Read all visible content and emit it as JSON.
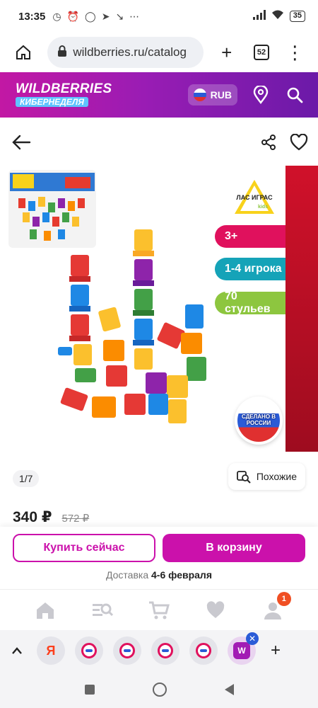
{
  "status": {
    "time": "13:35",
    "battery": "35"
  },
  "browser": {
    "url": "wildberries.ru/catalog",
    "tabs_count": "52"
  },
  "header": {
    "logo_line1": "WILDBERRIES",
    "logo_line2": "КИБЕРНЕДЕЛЯ",
    "currency": "RUB"
  },
  "gallery": {
    "brand_name": "ЛАС ИГРАС",
    "brand_sub": "kids",
    "age": "3+",
    "players": "1-4 игрока",
    "chairs": "70 стульев",
    "made_in": "СДЕЛАНО В РОССИИ",
    "counter": "1/7",
    "similar_label": "Похожие"
  },
  "price": {
    "current": "340 ₽",
    "old": "572 ₽"
  },
  "actions": {
    "buy_now": "Купить сейчас",
    "add_to_cart": "В корзину"
  },
  "delivery": {
    "label": "Доставка",
    "dates": "4-6 февраля"
  },
  "appnav": {
    "profile_badge": "1"
  },
  "colors": {
    "brand": "#cb11ab",
    "header_start": "#c218a4",
    "header_end": "#6b1aa8"
  }
}
